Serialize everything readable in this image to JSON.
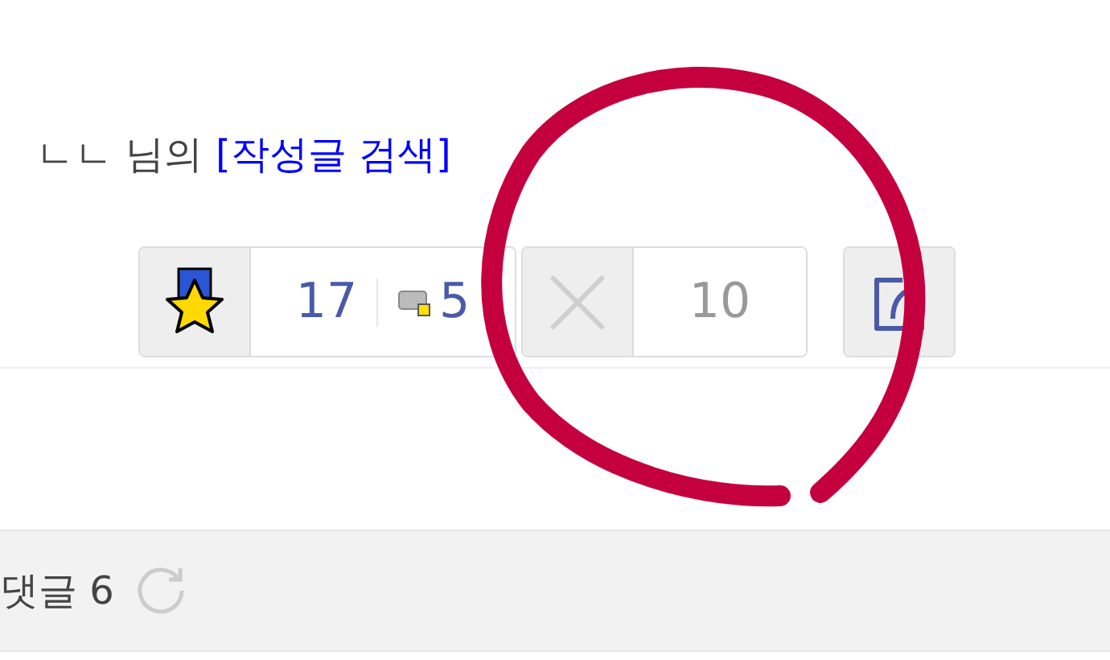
{
  "author_line": {
    "name": "ㄴㄴ",
    "suffix": "님의",
    "link": "[작성글 검색]"
  },
  "actions": [
    {
      "kind": "recommend",
      "count": "17",
      "sub_count": "5"
    },
    {
      "kind": "dislike",
      "count": "10"
    },
    {
      "kind": "share"
    }
  ],
  "comments": {
    "label": "댓글 6"
  }
}
